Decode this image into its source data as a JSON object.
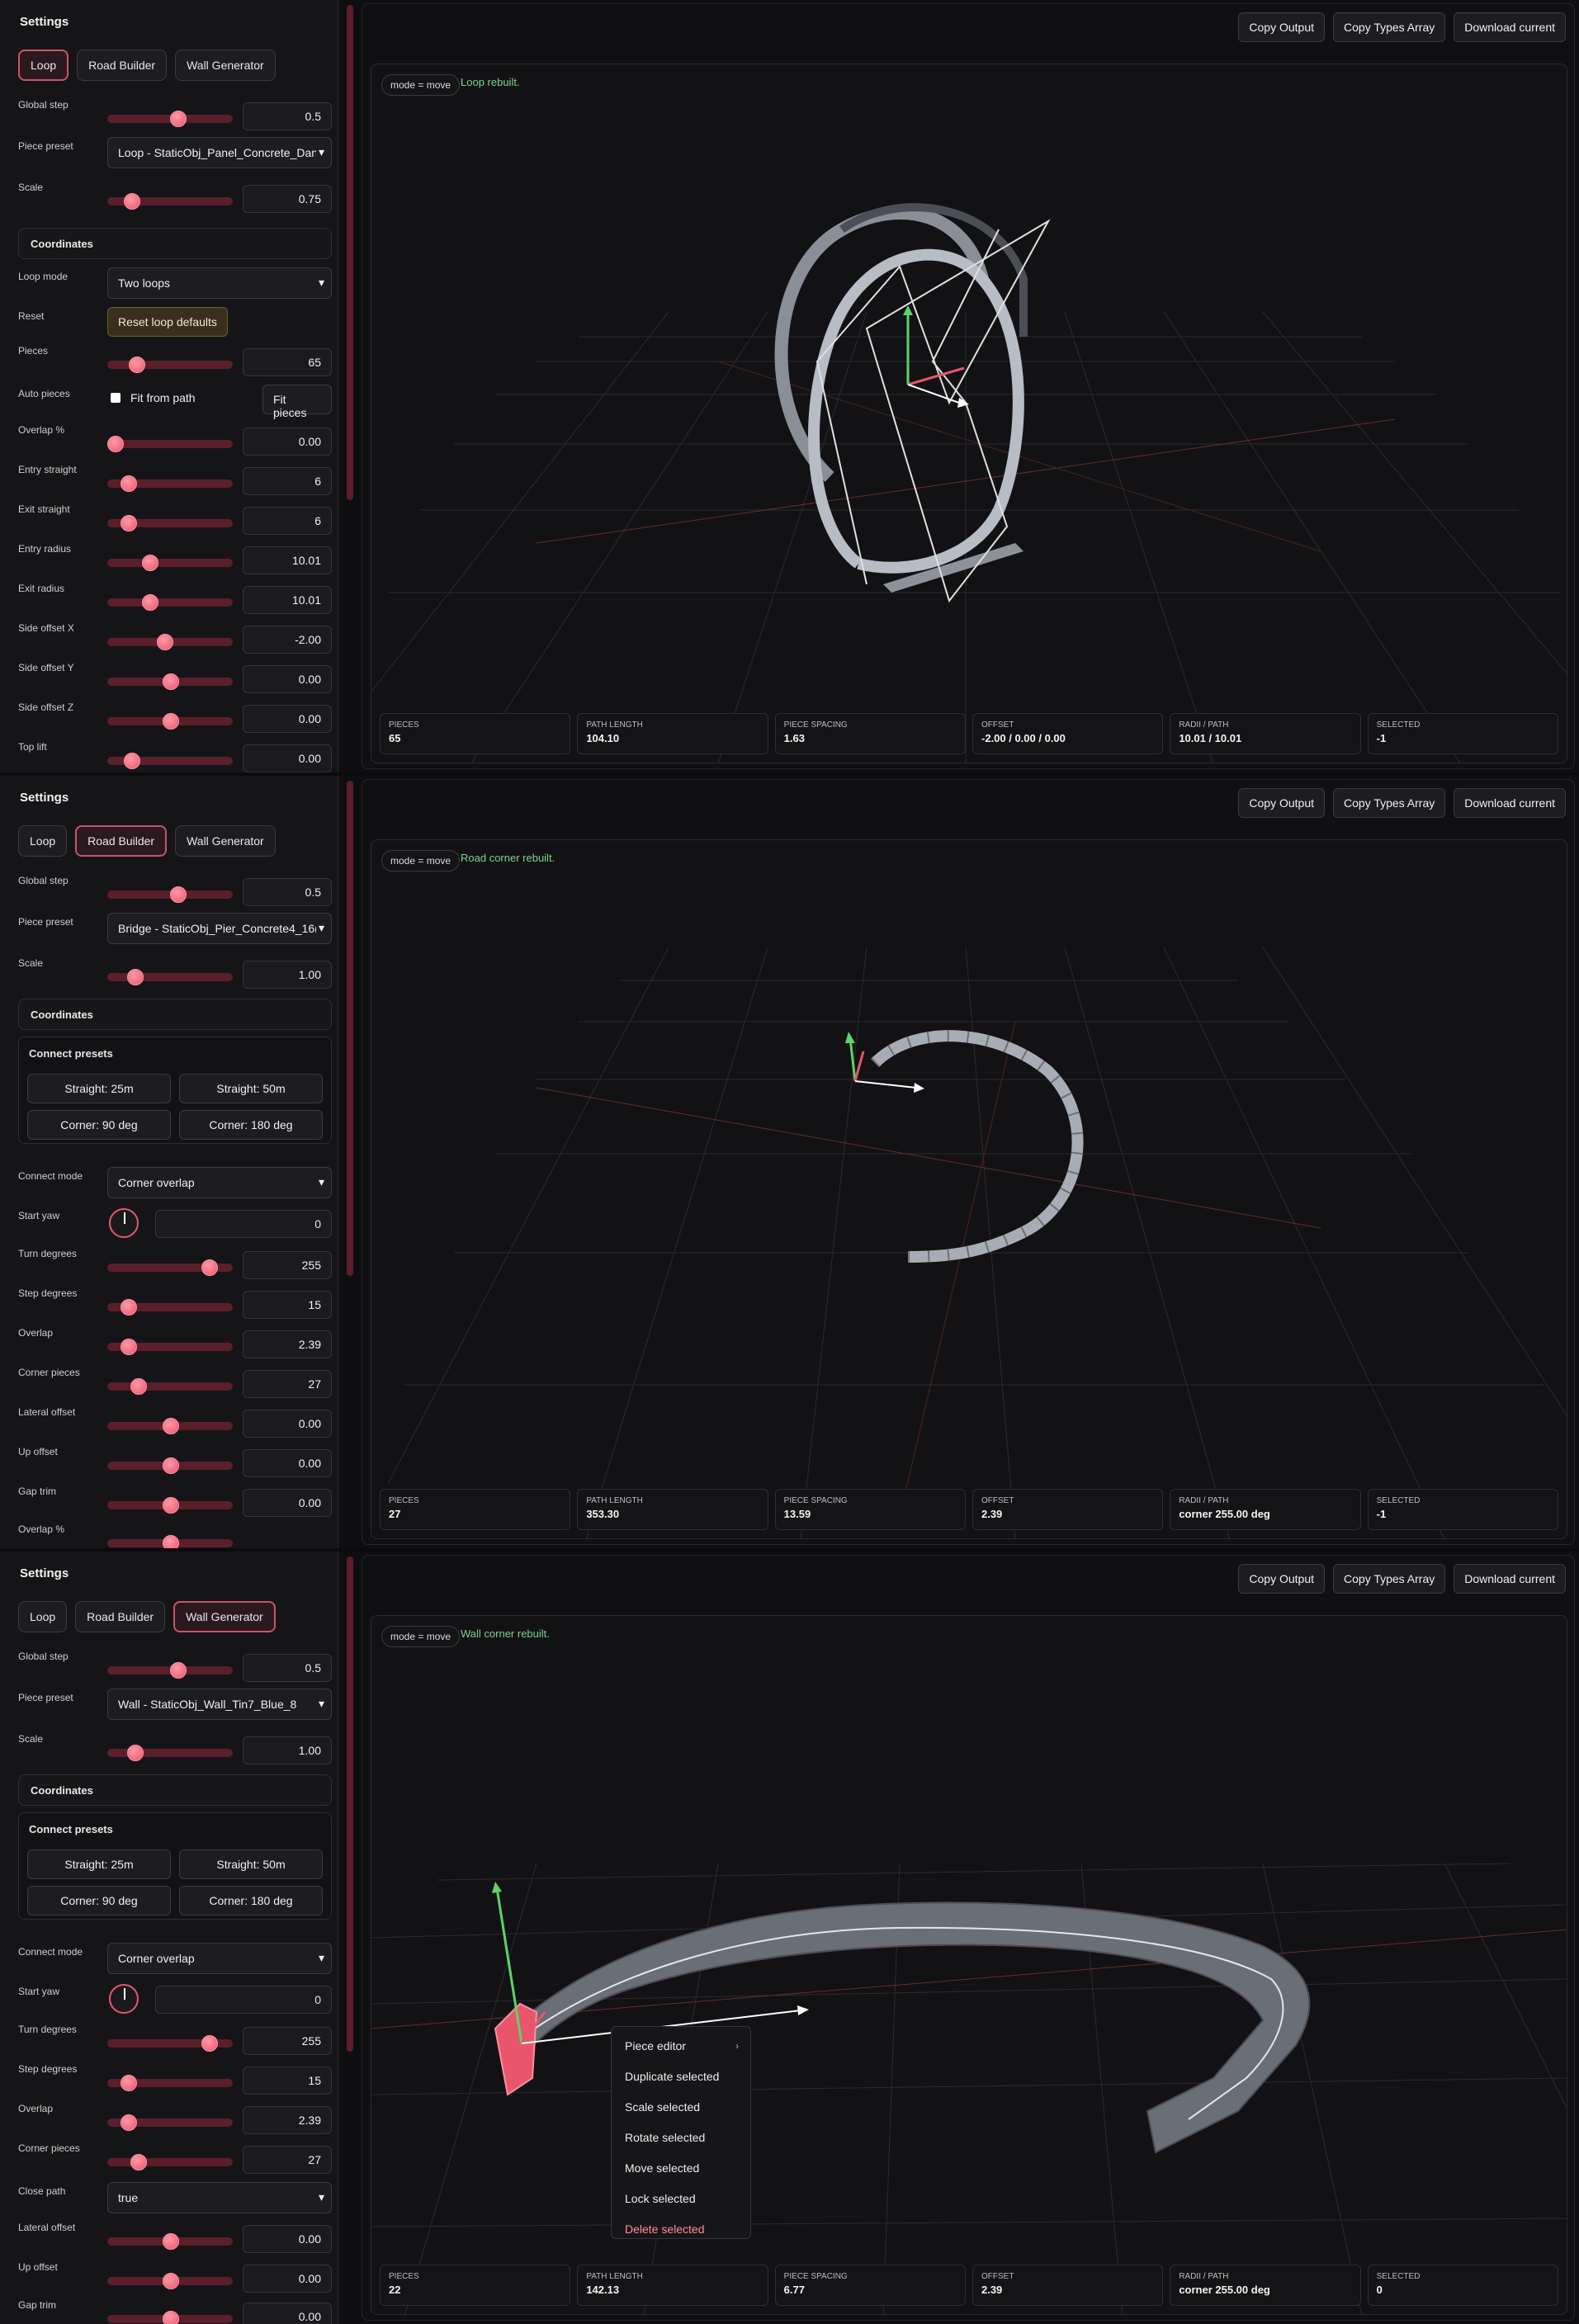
{
  "common": {
    "sidebar_title": "Settings",
    "tabs": [
      "Loop",
      "Road Builder",
      "Wall Generator"
    ],
    "top_buttons": [
      "Copy Output",
      "Copy Types Array",
      "Download current"
    ],
    "mode_label": "mode = move",
    "stat_labels": [
      "PIECES",
      "PATH LENGTH",
      "PIECE SPACING",
      "OFFSET",
      "RADII / PATH",
      "SELECTED"
    ],
    "coordinates_label": "Coordinates",
    "connect_presets_label": "Connect presets",
    "preset_buttons": [
      "Straight: 25m",
      "Straight: 50m",
      "Corner: 90 deg",
      "Corner: 180 deg"
    ],
    "colors": {
      "accent": "#e8566c",
      "status_ok": "#7bd48a",
      "axis_green": "#5bd46a",
      "axis_red": "#e8566c"
    }
  },
  "panel1": {
    "active_tab": "Loop",
    "status": "Loop rebuilt.",
    "global_step": {
      "label": "Global step",
      "value": "0.5"
    },
    "piece_preset": {
      "label": "Piece preset",
      "value": "Loop - StaticObj_Panel_Concrete_Dan"
    },
    "scale": {
      "label": "Scale",
      "value": "0.75"
    },
    "loop_mode": {
      "label": "Loop mode",
      "value": "Two loops"
    },
    "reset": {
      "label": "Reset",
      "button": "Reset loop defaults"
    },
    "pieces": {
      "label": "Pieces",
      "value": "65"
    },
    "auto_pieces": {
      "label": "Auto pieces",
      "checkbox": "Fit from path",
      "button": "Fit pieces"
    },
    "overlap": {
      "label": "Overlap %",
      "value": "0.00"
    },
    "entry_straight": {
      "label": "Entry straight",
      "value": "6"
    },
    "exit_straight": {
      "label": "Exit straight",
      "value": "6"
    },
    "entry_radius": {
      "label": "Entry radius",
      "value": "10.01"
    },
    "exit_radius": {
      "label": "Exit radius",
      "value": "10.01"
    },
    "side_x": {
      "label": "Side offset X",
      "value": "-2.00"
    },
    "side_y": {
      "label": "Side offset Y",
      "value": "0.00"
    },
    "side_z": {
      "label": "Side offset Z",
      "value": "0.00"
    },
    "top_lift": {
      "label": "Top lift",
      "value": "0.00"
    },
    "stats": [
      "65",
      "104.10",
      "1.63",
      "-2.00 / 0.00 / 0.00",
      "10.01 / 10.01",
      "-1"
    ]
  },
  "panel2": {
    "active_tab": "Road Builder",
    "status": "Road corner rebuilt.",
    "global_step": {
      "label": "Global step",
      "value": "0.5"
    },
    "piece_preset": {
      "label": "Piece preset",
      "value": "Bridge - StaticObj_Pier_Concrete4_16("
    },
    "scale": {
      "label": "Scale",
      "value": "1.00"
    },
    "connect_mode": {
      "label": "Connect mode",
      "value": "Corner overlap"
    },
    "start_yaw": {
      "label": "Start yaw",
      "value": "0"
    },
    "turn_degrees": {
      "label": "Turn degrees",
      "value": "255"
    },
    "step_degrees": {
      "label": "Step degrees",
      "value": "15"
    },
    "overlap": {
      "label": "Overlap",
      "value": "2.39"
    },
    "corner_pieces": {
      "label": "Corner pieces",
      "value": "27"
    },
    "lateral_offset": {
      "label": "Lateral offset",
      "value": "0.00"
    },
    "up_offset": {
      "label": "Up offset",
      "value": "0.00"
    },
    "gap_trim": {
      "label": "Gap trim",
      "value": "0.00"
    },
    "overlap_pct": {
      "label": "Overlap %"
    },
    "stats": [
      "27",
      "353.30",
      "13.59",
      "2.39",
      "corner 255.00 deg",
      "-1"
    ]
  },
  "panel3": {
    "active_tab": "Wall Generator",
    "status": "Wall corner rebuilt.",
    "global_step": {
      "label": "Global step",
      "value": "0.5"
    },
    "piece_preset": {
      "label": "Piece preset",
      "value": "Wall - StaticObj_Wall_Tin7_Blue_8"
    },
    "scale": {
      "label": "Scale",
      "value": "1.00"
    },
    "connect_mode": {
      "label": "Connect mode",
      "value": "Corner overlap"
    },
    "start_yaw": {
      "label": "Start yaw",
      "value": "0"
    },
    "turn_degrees": {
      "label": "Turn degrees",
      "value": "255"
    },
    "step_degrees": {
      "label": "Step degrees",
      "value": "15"
    },
    "overlap": {
      "label": "Overlap",
      "value": "2.39"
    },
    "corner_pieces": {
      "label": "Corner pieces",
      "value": "27"
    },
    "close_path": {
      "label": "Close path",
      "value": "true"
    },
    "lateral_offset": {
      "label": "Lateral offset",
      "value": "0.00"
    },
    "up_offset": {
      "label": "Up offset",
      "value": "0.00"
    },
    "gap_trim": {
      "label": "Gap trim",
      "value": "0.00"
    },
    "context_menu": [
      "Piece editor",
      "Duplicate selected",
      "Scale selected",
      "Rotate selected",
      "Move selected",
      "Lock selected",
      "Delete selected"
    ],
    "stats": [
      "22",
      "142.13",
      "6.77",
      "2.39",
      "corner 255.00 deg",
      "0"
    ]
  }
}
